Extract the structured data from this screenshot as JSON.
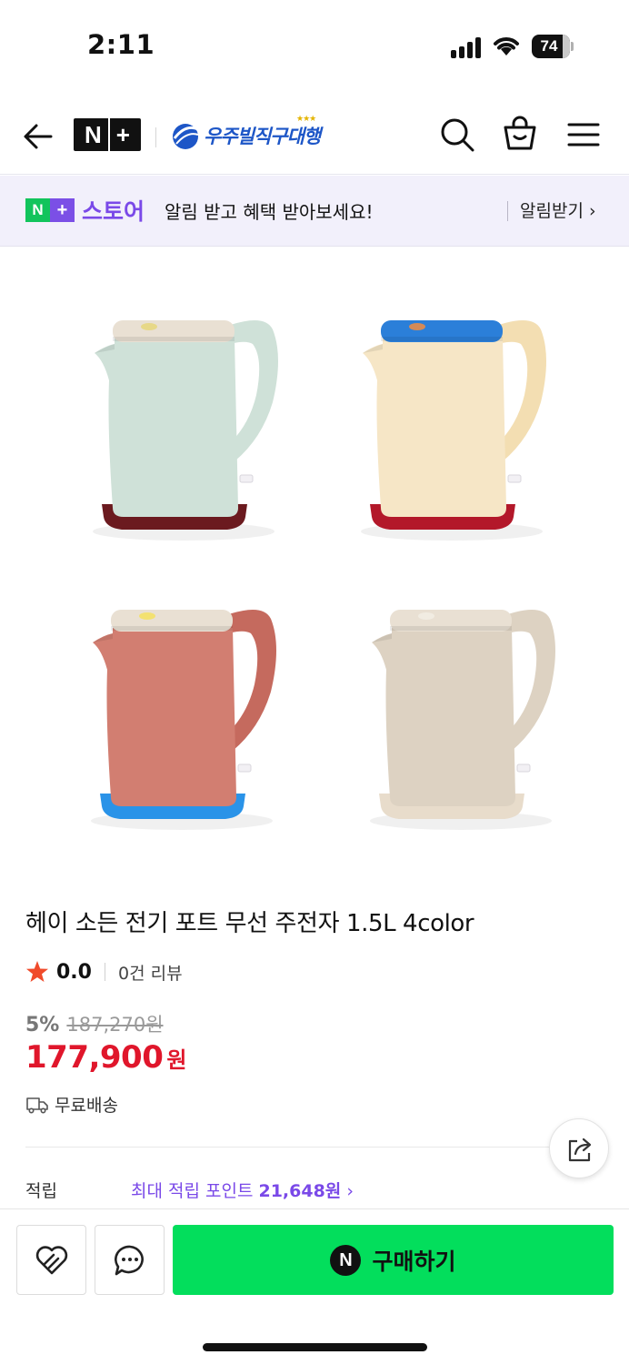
{
  "status_bar": {
    "time": "2:11",
    "battery": "74"
  },
  "header": {
    "brand_badge": [
      "N",
      "+"
    ],
    "store_name": "우주빌직구대행",
    "store_stars": "★★★"
  },
  "banner": {
    "badge_n": "N",
    "badge_plus": "+",
    "store_label": "스토어",
    "message": "알림 받고 혜택 받아보세요!",
    "link": "알림받기 ›"
  },
  "gallery": {
    "kettles": [
      {
        "name": "mint-kettle",
        "body": "#cfe1d8",
        "handle": "#cfe1d8",
        "lid": "#e9e0d3",
        "lid_dot": "#e7d888",
        "base": "#6b1a1f"
      },
      {
        "name": "cream-kettle",
        "body": "#f6e6c6",
        "handle": "#f3deb2",
        "lid": "#2b7fd9",
        "lid_dot": "#d48a57",
        "base": "#b3182a"
      },
      {
        "name": "terracotta-kettle",
        "body": "#d27e71",
        "handle": "#c56a5e",
        "lid": "#e9e0d3",
        "lid_dot": "#f3e171",
        "base": "#2a93e8"
      },
      {
        "name": "beige-kettle",
        "body": "#ddd2c2",
        "handle": "#ddd2c2",
        "lid": "#e9e0d3",
        "lid_dot": "#f1ece2",
        "base": "#e8dccb"
      }
    ]
  },
  "product": {
    "title": "헤이 소든 전기 포트 무선 주전자 1.5L 4color",
    "rating": "0.0",
    "review_count": "0건 리뷰",
    "discount_rate": "5%",
    "original_price": "187,270원",
    "sale_price": "177,900",
    "currency": "원",
    "shipping": "무료배송",
    "points_label": "적립",
    "points_prefix": "최대 적립 포인트 ",
    "points_amount": "21,648원",
    "points_arrow": " ›"
  },
  "bottom_bar": {
    "buy_label": "구매하기",
    "npay_glyph": "N"
  },
  "colors": {
    "accent_purple": "#7a49e8",
    "sale_red": "#e0162b",
    "buy_green": "#03de5c"
  }
}
